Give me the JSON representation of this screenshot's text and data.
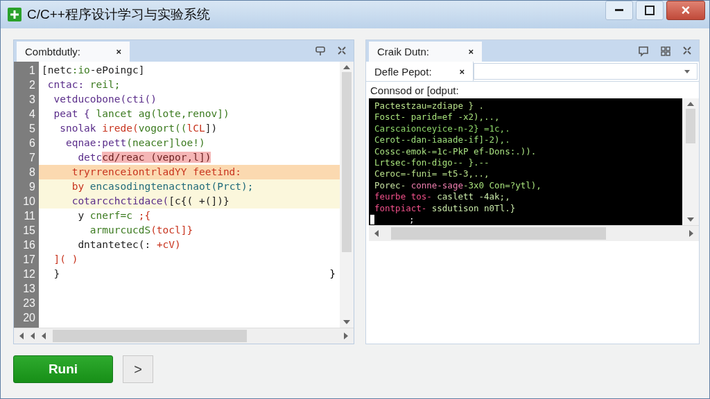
{
  "window": {
    "title": "C/C++程序设计学习与实验系统",
    "controls": [
      {
        "kind": "minimize"
      },
      {
        "kind": "maximize"
      },
      {
        "kind": "close",
        "label": "×"
      }
    ]
  },
  "editor": {
    "tab": {
      "label": "Combtdutly:",
      "close": "×"
    },
    "lines": [
      {
        "num": "1",
        "kind": "plain",
        "tokens": [
          {
            "t": "[netc",
            "color": "#222222"
          },
          {
            "t": ":io",
            "color": "#3b7a1f"
          },
          {
            "t": "-ePoingc]",
            "color": "#222222"
          }
        ]
      },
      {
        "num": "2",
        "kind": "plain",
        "tokens": [
          {
            "t": " cntac: ",
            "color": "#5a2d8a"
          },
          {
            "t": "reil;",
            "color": "#3b7a1f"
          }
        ]
      },
      {
        "num": "3",
        "kind": "plain",
        "tokens": [
          {
            "t": "  vetducobone(cti()",
            "color": "#5a2d8a"
          }
        ]
      },
      {
        "num": "4",
        "kind": "plain",
        "tokens": [
          {
            "t": "  peat { ",
            "color": "#5a2d8a"
          },
          {
            "t": "lancet ag(lote,renov])",
            "color": "#3b7a1f"
          }
        ]
      },
      {
        "num": "5",
        "kind": "plain",
        "tokens": [
          {
            "t": "   snolak ",
            "color": "#5a2d8a"
          },
          {
            "t": "irede(",
            "color": "#c8341e"
          },
          {
            "t": "vogort((",
            "color": "#3b7a1f"
          },
          {
            "t": "lCL",
            "color": "#c8341e"
          },
          {
            "t": "])",
            "color": "#222222"
          }
        ]
      },
      {
        "num": "6",
        "kind": "plain",
        "tokens": [
          {
            "t": "    eqnae:pett",
            "color": "#5a2d8a"
          },
          {
            "t": "(neacer]loe!)",
            "color": "#3b7a1f"
          }
        ]
      },
      {
        "num": "7",
        "kind": "error",
        "tokens": [
          {
            "t": "      detc",
            "color": "#5a2d8a"
          },
          {
            "t": "cd/reac (vepor,l])",
            "color": "#6a1f1f"
          }
        ]
      },
      {
        "num": "8",
        "kind": "warning",
        "tokens": [
          {
            "t": "     tryrrenceiontrladYY feetind:",
            "color": "#c8341e"
          }
        ]
      },
      {
        "num": "9",
        "kind": "note",
        "tokens": [
          {
            "t": "     by ",
            "color": "#c8341e"
          },
          {
            "t": "encasodingtenactnaot(Prct);",
            "color": "#1f6a7a"
          }
        ]
      },
      {
        "num": "10",
        "kind": "note",
        "tokens": [
          {
            "t": "     cotarcchctidace(",
            "color": "#5a2d8a"
          },
          {
            "t": "[c{( +(])}",
            "color": "#222222"
          }
        ]
      },
      {
        "num": "11",
        "kind": "plain",
        "tokens": [
          {
            "t": "      y ",
            "color": "#222222"
          },
          {
            "t": "cnerf=c ",
            "color": "#3b7a1f"
          },
          {
            "t": ";{",
            "color": "#c8341e"
          }
        ]
      },
      {
        "num": "15",
        "kind": "plain",
        "tokens": [
          {
            "t": "        armurcucdS",
            "color": "#3b7a1f"
          },
          {
            "t": "(tocl]}",
            "color": "#c8341e"
          }
        ]
      },
      {
        "num": "16",
        "kind": "plain",
        "tokens": [
          {
            "t": "      dntantetec(: ",
            "color": "#222222"
          },
          {
            "t": "+cV)",
            "color": "#c8341e"
          }
        ]
      },
      {
        "num": "17",
        "kind": "plain",
        "tokens": [
          {
            "t": "  ]( )",
            "color": "#c8341e"
          }
        ]
      },
      {
        "num": "12",
        "kind": "plain",
        "tokens": [
          {
            "t": "  }",
            "color": "#222222"
          }
        ],
        "tail": "}"
      },
      {
        "num": "13",
        "kind": "plain"
      },
      {
        "num": "23",
        "kind": "plain"
      },
      {
        "num": "20",
        "kind": "plain"
      }
    ]
  },
  "output": {
    "tab": {
      "label": "Craik Dutn:",
      "close": "×"
    },
    "subtab": {
      "label": "Defle Pepot:",
      "close": "×"
    },
    "label": "Connsod or [odput:",
    "console": [
      {
        "cursor": false,
        "segments": [
          {
            "t": "Pactestzau=zdiape } .",
            "color": "#b8e08a"
          }
        ]
      },
      {
        "cursor": false,
        "segments": [
          {
            "t": "Fosct- parid=ef -x2),..,",
            "color": "#a6e07a"
          }
        ]
      },
      {
        "cursor": false,
        "segments": [
          {
            "t": "Carscaionceyice-n-2} =1c,.",
            "color": "#8fd86a"
          }
        ]
      },
      {
        "cursor": false,
        "segments": [
          {
            "t": "Cerot--dan-iaaade-if]-2),.",
            "color": "#9ee07c"
          }
        ]
      },
      {
        "cursor": false,
        "segments": [
          {
            "t": "Cossc-emok-=1c-PkP ef-Dons:.)).",
            "color": "#a8e080"
          }
        ]
      },
      {
        "cursor": false,
        "segments": [
          {
            "t": "Lrtsec-fon-digo-- }.--",
            "color": "#a6e07a"
          }
        ]
      },
      {
        "cursor": false,
        "segments": [
          {
            "t": "Ceroc=-funi= =t5-3,..,",
            "color": "#b8e08a"
          }
        ]
      },
      {
        "cursor": false,
        "segments": [
          {
            "t": "Porec- ",
            "color": "#c6e0a0"
          },
          {
            "t": "conne-sage",
            "color": "#f07fb0"
          },
          {
            "t": "-3x0 Con=?ytl),",
            "color": "#a6e07a"
          }
        ]
      },
      {
        "cursor": false,
        "segments": [
          {
            "t": "feurbe tos- ",
            "color": "#f0508a"
          },
          {
            "t": "caslett -4ak;,",
            "color": "#c8e8a8"
          }
        ]
      },
      {
        "cursor": false,
        "segments": [
          {
            "t": "fontpiact- ",
            "color": "#f0508a"
          },
          {
            "t": "ssdutison n0Tl.}",
            "color": "#c8e8a8"
          }
        ]
      },
      {
        "cursor": true,
        "segments": [
          {
            "t": ";",
            "color": "#ffffff"
          }
        ]
      }
    ]
  },
  "actions": {
    "run": "Runi",
    "next": ">"
  }
}
